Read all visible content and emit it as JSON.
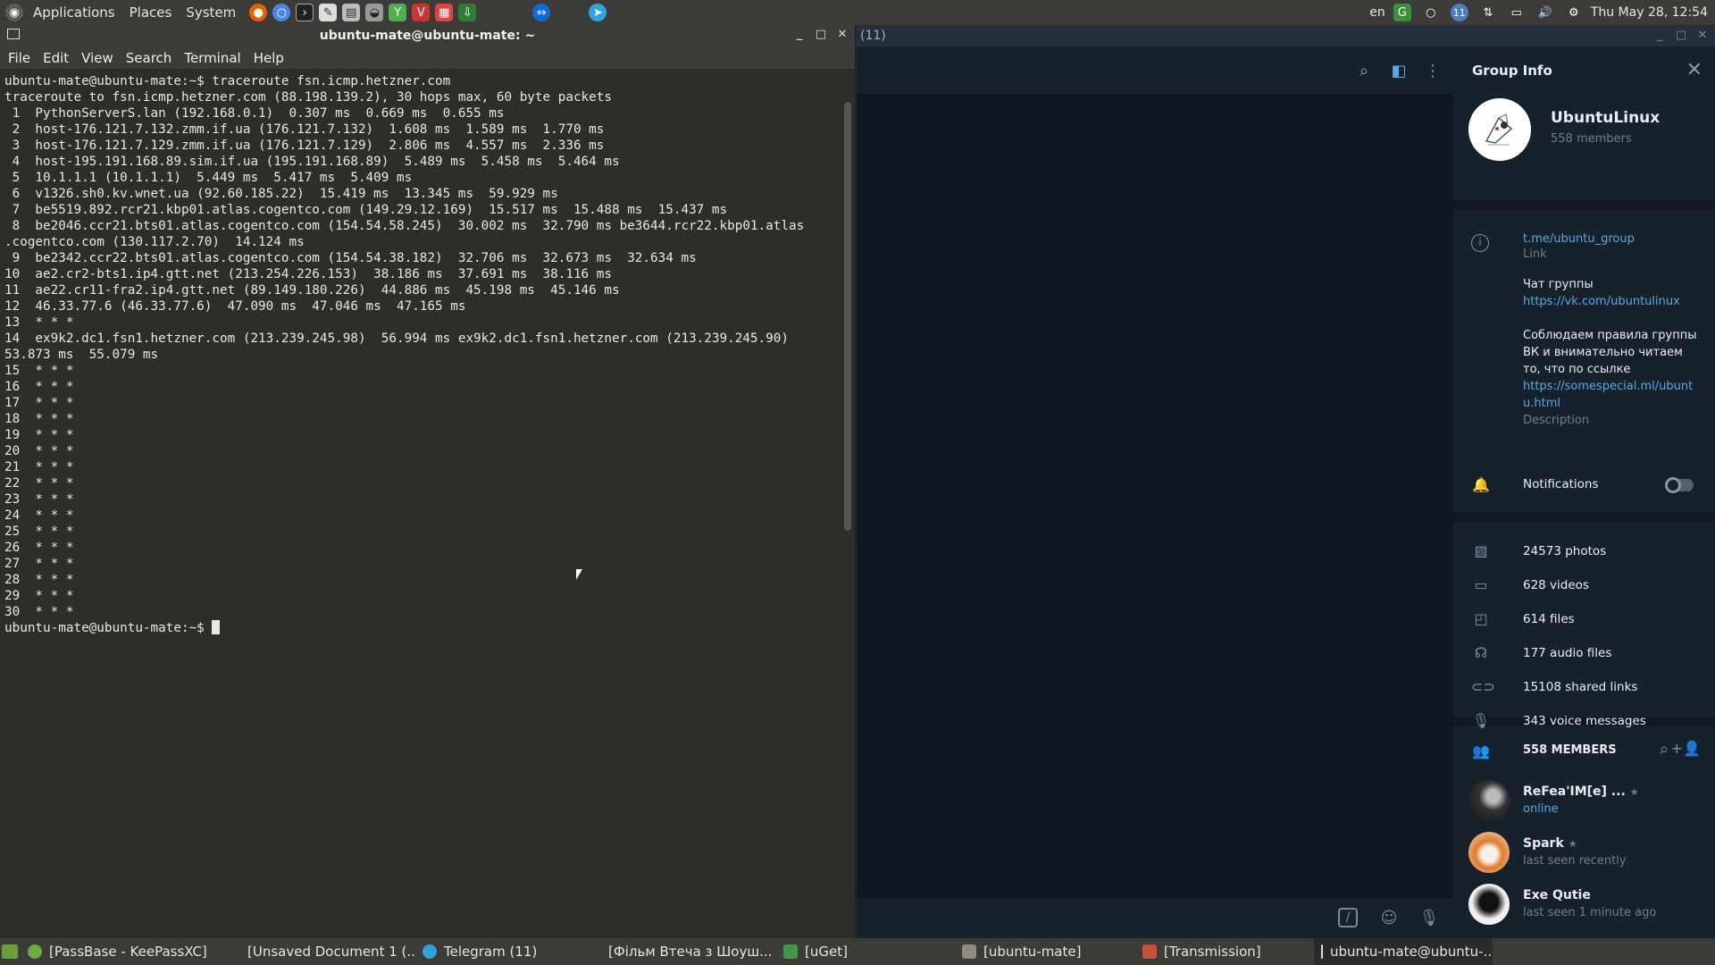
{
  "top_panel": {
    "menus": [
      "Applications",
      "Places",
      "System"
    ],
    "language": "en",
    "update_badge": "11",
    "clock": "Thu May 28, 12:54"
  },
  "terminal": {
    "title": "ubuntu-mate@ubuntu-mate: ~",
    "menu": [
      "File",
      "Edit",
      "View",
      "Search",
      "Terminal",
      "Help"
    ],
    "lines": [
      "ubuntu-mate@ubuntu-mate:~$ traceroute fsn.icmp.hetzner.com",
      "traceroute to fsn.icmp.hetzner.com (88.198.139.2), 30 hops max, 60 byte packets",
      " 1  PythonServerS.lan (192.168.0.1)  0.307 ms  0.669 ms  0.655 ms",
      " 2  host-176.121.7.132.zmm.if.ua (176.121.7.132)  1.608 ms  1.589 ms  1.770 ms",
      " 3  host-176.121.7.129.zmm.if.ua (176.121.7.129)  2.806 ms  4.557 ms  2.336 ms",
      " 4  host-195.191.168.89.sim.if.ua (195.191.168.89)  5.489 ms  5.458 ms  5.464 ms",
      " 5  10.1.1.1 (10.1.1.1)  5.449 ms  5.417 ms  5.409 ms",
      " 6  v1326.sh0.kv.wnet.ua (92.60.185.22)  15.419 ms  13.345 ms  59.929 ms",
      " 7  be5519.892.rcr21.kbp01.atlas.cogentco.com (149.29.12.169)  15.517 ms  15.488 ms  15.437 ms",
      " 8  be2046.ccr21.bts01.atlas.cogentco.com (154.54.58.245)  30.002 ms  32.790 ms be3644.rcr22.kbp01.atlas",
      ".cogentco.com (130.117.2.70)  14.124 ms",
      " 9  be2342.ccr22.bts01.atlas.cogentco.com (154.54.38.182)  32.706 ms  32.673 ms  32.634 ms",
      "10  ae2.cr2-bts1.ip4.gtt.net (213.254.226.153)  38.186 ms  37.691 ms  38.116 ms",
      "11  ae22.cr11-fra2.ip4.gtt.net (89.149.180.226)  44.886 ms  45.198 ms  45.146 ms",
      "12  46.33.77.6 (46.33.77.6)  47.090 ms  47.046 ms  47.165 ms",
      "13  * * *",
      "14  ex9k2.dc1.fsn1.hetzner.com (213.239.245.98)  56.994 ms ex9k2.dc1.fsn1.hetzner.com (213.239.245.90)",
      "53.873 ms  55.079 ms",
      "15  * * *",
      "16  * * *",
      "17  * * *",
      "18  * * *",
      "19  * * *",
      "20  * * *",
      "21  * * *",
      "22  * * *",
      "23  * * *",
      "24  * * *",
      "25  * * *",
      "26  * * *",
      "27  * * *",
      "28  * * *",
      "29  * * *",
      "30  * * *"
    ],
    "prompt": "ubuntu-mate@ubuntu-mate:~$ "
  },
  "telegram": {
    "window_title": "(11)",
    "group_info": {
      "header": "Group Info",
      "name": "UbuntuLinux",
      "members": "558 members",
      "link": "t.me/ubuntu_group",
      "link_label": "Link",
      "desc_line1": "Чат группы",
      "desc_link1": "https://vk.com/ubuntulinux",
      "desc_text": "Соблюдаем правила группы ВК и внимательно читаем то, что по ссылке",
      "desc_link2": "https://somespecial.ml/ubuntu.html",
      "desc_label": "Description",
      "notifications": "Notifications",
      "media": [
        {
          "icon": "photo-icon",
          "label": "24573 photos"
        },
        {
          "icon": "video-icon",
          "label": "628 videos"
        },
        {
          "icon": "file-icon",
          "label": "614 files"
        },
        {
          "icon": "headphones-icon",
          "label": "177 audio files"
        },
        {
          "icon": "link-icon",
          "label": "15108 shared links"
        },
        {
          "icon": "microphone-icon",
          "label": "343 voice messages"
        }
      ],
      "members_header": "558 MEMBERS",
      "member_list": [
        {
          "name": "ReFea'IM[e] ...",
          "status": "online"
        },
        {
          "name": "Spark",
          "status": "last seen recently"
        },
        {
          "name": "Exe Qutie",
          "status": "last seen 1 minute ago"
        }
      ]
    }
  },
  "taskbar": {
    "tasks": [
      {
        "label": "[PassBase - KeePassXC]",
        "color": "#6cae3e"
      },
      {
        "label": "[Unsaved Document 1 (...",
        "color": "#cfcfcf"
      },
      {
        "label": "Telegram (11)",
        "color": "#2ca5e0"
      },
      {
        "label": "[Фільм Втеча з Шоуш...",
        "color": "#4a7fd6"
      },
      {
        "label": "[uGet]",
        "color": "#3e9a49"
      },
      {
        "label": "[ubuntu-mate]",
        "color": "#8d8d7a"
      },
      {
        "label": "[Transmission]",
        "color": "#c94f3a"
      },
      {
        "label": "ubuntu-mate@ubuntu-...",
        "color": "#e0e0e0"
      }
    ]
  }
}
